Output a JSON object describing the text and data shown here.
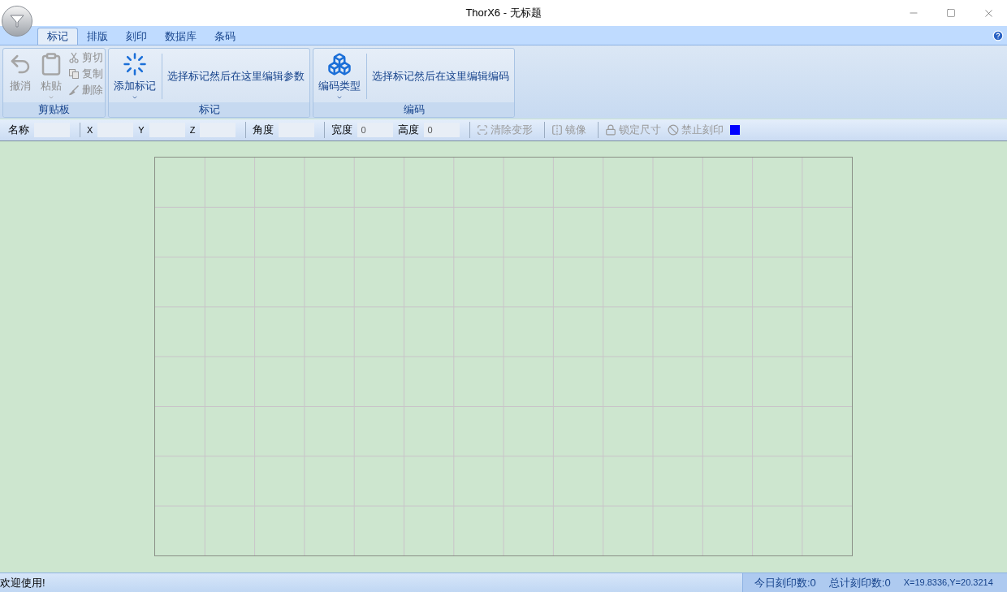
{
  "window": {
    "title": "ThorX6 - 无标题"
  },
  "tabs": [
    {
      "label": "标记",
      "selected": true
    },
    {
      "label": "排版",
      "selected": false
    },
    {
      "label": "刻印",
      "selected": false
    },
    {
      "label": "数据库",
      "selected": false
    },
    {
      "label": "条码",
      "selected": false
    }
  ],
  "ribbon_groups": [
    {
      "label": "剪贴板",
      "items": [
        {
          "kind": "large",
          "label": "撤消",
          "disabled": true,
          "dropdown": false
        },
        {
          "kind": "large",
          "label": "粘贴",
          "disabled": true,
          "dropdown": true
        },
        {
          "kind": "small",
          "label": "剪切",
          "disabled": true
        },
        {
          "kind": "small",
          "label": "复制",
          "disabled": true
        },
        {
          "kind": "small",
          "label": "删除",
          "disabled": true
        }
      ]
    },
    {
      "label": "标记",
      "items": [
        {
          "kind": "large",
          "label": "添加标记",
          "disabled": false,
          "dropdown": true
        },
        {
          "kind": "hint",
          "label": "选择标记然后在这里编辑参数"
        }
      ]
    },
    {
      "label": "编码",
      "items": [
        {
          "kind": "large",
          "label": "编码类型",
          "disabled": false,
          "dropdown": true
        },
        {
          "kind": "hint",
          "label": "选择标记然后在这里编辑编码"
        }
      ]
    }
  ],
  "property_bar": [
    [
      {
        "kind": "field",
        "label": "名称"
      }
    ],
    [
      {
        "kind": "field",
        "label": "X"
      },
      {
        "kind": "field",
        "label": "Y"
      },
      {
        "kind": "field",
        "label": "Z"
      }
    ],
    [
      {
        "kind": "field",
        "label": "角度"
      }
    ],
    [
      {
        "kind": "field",
        "label": "宽度",
        "value": "0"
      },
      {
        "kind": "field",
        "label": "高度",
        "value": "0"
      }
    ],
    [
      {
        "kind": "tool",
        "label": "清除变形",
        "disabled": true
      }
    ],
    [
      {
        "kind": "tool",
        "label": "镜像",
        "disabled": true
      }
    ],
    [
      {
        "kind": "tool",
        "label": "锁定尺寸",
        "disabled": true
      },
      {
        "kind": "tool",
        "label": "禁止刻印",
        "disabled": true
      },
      {
        "kind": "swatch",
        "color": "#0000ff"
      }
    ]
  ],
  "status_bar": {
    "message": "欢迎使用!",
    "counters": [
      "今日刻印数:0",
      "总计刻印数:0"
    ],
    "coordinates": "X=19.8336,Y=20.3214"
  }
}
